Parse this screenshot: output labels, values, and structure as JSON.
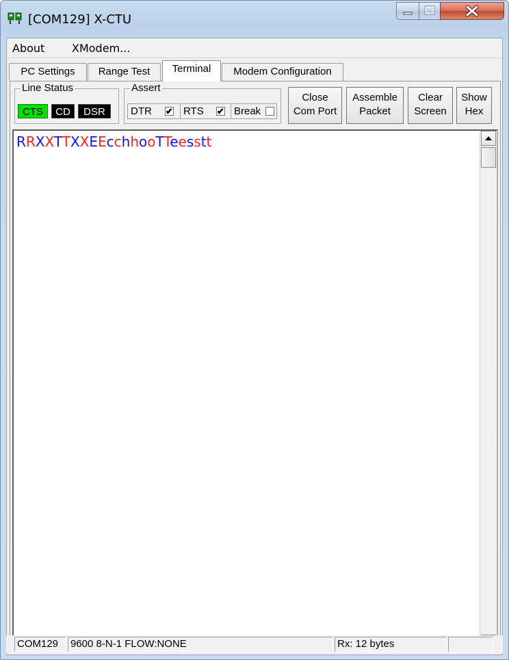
{
  "window": {
    "title": "[COM129] X-CTU"
  },
  "menu": {
    "about": "About",
    "xmodem": "XModem..."
  },
  "tabs": [
    {
      "label": "PC Settings"
    },
    {
      "label": "Range Test"
    },
    {
      "label": "Terminal"
    },
    {
      "label": "Modem Configuration"
    }
  ],
  "line_status": {
    "title": "Line Status",
    "cts": "CTS",
    "cd": "CD",
    "dsr": "DSR",
    "colors": {
      "active": "#00e000",
      "inactive": "#000000"
    }
  },
  "assert": {
    "title": "Assert",
    "dtr": {
      "label": "DTR",
      "checked": "✔"
    },
    "rts": {
      "label": "RTS",
      "checked": "✔"
    },
    "brk": {
      "label": "Break",
      "checked": ""
    }
  },
  "buttons": {
    "close_port": [
      "Close",
      "Com Port"
    ],
    "assemble": [
      "Assemble",
      "Packet"
    ],
    "clear": [
      "Clear",
      "Screen"
    ],
    "show_hex": [
      "Show",
      "Hex"
    ]
  },
  "terminal": {
    "text": "RRXXTTXXEEcchhooTTeesstt",
    "colors": {
      "sent": "#1010ff",
      "received": "#ff2020"
    },
    "chars": [
      {
        "c": "R",
        "d": "sent"
      },
      {
        "c": "R",
        "d": "recv"
      },
      {
        "c": "X",
        "d": "sent"
      },
      {
        "c": "X",
        "d": "recv"
      },
      {
        "c": "T",
        "d": "sent"
      },
      {
        "c": "T",
        "d": "recv"
      },
      {
        "c": "X",
        "d": "sent"
      },
      {
        "c": "X",
        "d": "recv"
      },
      {
        "c": "E",
        "d": "sent"
      },
      {
        "c": "E",
        "d": "recv"
      },
      {
        "c": "c",
        "d": "sent"
      },
      {
        "c": "c",
        "d": "recv"
      },
      {
        "c": "h",
        "d": "sent"
      },
      {
        "c": "h",
        "d": "recv"
      },
      {
        "c": "o",
        "d": "sent"
      },
      {
        "c": "o",
        "d": "recv"
      },
      {
        "c": "T",
        "d": "sent"
      },
      {
        "c": "T",
        "d": "recv"
      },
      {
        "c": "e",
        "d": "sent"
      },
      {
        "c": "e",
        "d": "recv"
      },
      {
        "c": "s",
        "d": "sent"
      },
      {
        "c": "s",
        "d": "recv"
      },
      {
        "c": "t",
        "d": "sent"
      },
      {
        "c": "t",
        "d": "recv"
      }
    ]
  },
  "status": {
    "port": "COM129",
    "settings": "9600 8-N-1  FLOW:NONE",
    "rx": "Rx: 12 bytes",
    "extra": ""
  },
  "icons": {
    "app": "xctu-app-icon",
    "minimize": "minimize-icon",
    "maximize": "maximize-icon",
    "close": "close-icon",
    "scroll_up": "scroll-up-arrow-icon",
    "scroll_down": "scroll-down-arrow-icon"
  }
}
